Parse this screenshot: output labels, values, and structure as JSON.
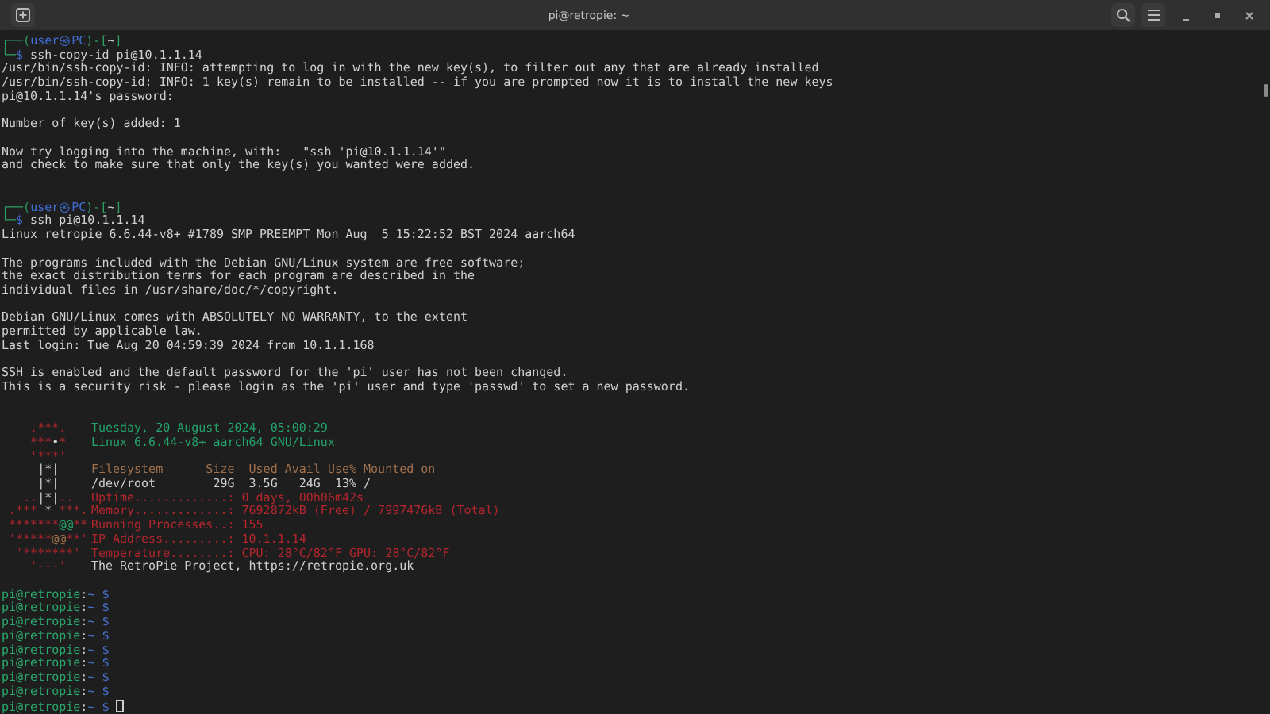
{
  "window": {
    "title": "pi@retropie: ~"
  },
  "lines": [
    {
      "kind": "text",
      "spans": [
        {
          "kind": "frame",
          "text": "┌──("
        },
        {
          "kind": "user",
          "text": "user㉿PC"
        },
        {
          "kind": "frame",
          "text": ")-["
        },
        {
          "kind": "plain",
          "text": "~"
        },
        {
          "kind": "frame",
          "text": "]"
        }
      ]
    },
    {
      "kind": "text",
      "spans": [
        {
          "kind": "frame",
          "text": "└─"
        },
        {
          "kind": "user",
          "text": "$"
        },
        {
          "kind": "plain",
          "text": " ssh-copy-id pi@10.1.1.14"
        }
      ]
    },
    {
      "kind": "text",
      "spans": [
        {
          "kind": "plain",
          "text": "/usr/bin/ssh-copy-id: INFO: attempting to log in with the new key(s), to filter out any that are already installed"
        }
      ]
    },
    {
      "kind": "text",
      "spans": [
        {
          "kind": "plain",
          "text": "/usr/bin/ssh-copy-id: INFO: 1 key(s) remain to be installed -- if you are prompted now it is to install the new keys"
        }
      ]
    },
    {
      "kind": "text",
      "spans": [
        {
          "kind": "plain",
          "text": "pi@10.1.1.14's password:"
        }
      ]
    },
    {
      "kind": "blank"
    },
    {
      "kind": "text",
      "spans": [
        {
          "kind": "plain",
          "text": "Number of key(s) added: 1"
        }
      ]
    },
    {
      "kind": "blank"
    },
    {
      "kind": "text",
      "spans": [
        {
          "kind": "plain",
          "text": "Now try logging into the machine, with:   \"ssh 'pi@10.1.1.14'\""
        }
      ]
    },
    {
      "kind": "text",
      "spans": [
        {
          "kind": "plain",
          "text": "and check to make sure that only the key(s) you wanted were added."
        }
      ]
    },
    {
      "kind": "blank"
    },
    {
      "kind": "blank"
    },
    {
      "kind": "text",
      "spans": [
        {
          "kind": "frame",
          "text": "┌──("
        },
        {
          "kind": "user",
          "text": "user㉿PC"
        },
        {
          "kind": "frame",
          "text": ")-["
        },
        {
          "kind": "plain",
          "text": "~"
        },
        {
          "kind": "frame",
          "text": "]"
        }
      ]
    },
    {
      "kind": "text",
      "spans": [
        {
          "kind": "frame",
          "text": "└─"
        },
        {
          "kind": "user",
          "text": "$"
        },
        {
          "kind": "plain",
          "text": " ssh pi@10.1.1.14"
        }
      ]
    },
    {
      "kind": "text",
      "spans": [
        {
          "kind": "plain",
          "text": "Linux retropie 6.6.44-v8+ #1789 SMP PREEMPT Mon Aug  5 15:22:52 BST 2024 aarch64"
        }
      ]
    },
    {
      "kind": "blank"
    },
    {
      "kind": "text",
      "spans": [
        {
          "kind": "plain",
          "text": "The programs included with the Debian GNU/Linux system are free software;"
        }
      ]
    },
    {
      "kind": "text",
      "spans": [
        {
          "kind": "plain",
          "text": "the exact distribution terms for each program are described in the"
        }
      ]
    },
    {
      "kind": "text",
      "spans": [
        {
          "kind": "plain",
          "text": "individual files in /usr/share/doc/*/copyright."
        }
      ]
    },
    {
      "kind": "blank"
    },
    {
      "kind": "text",
      "spans": [
        {
          "kind": "plain",
          "text": "Debian GNU/Linux comes with ABSOLUTELY NO WARRANTY, to the extent"
        }
      ]
    },
    {
      "kind": "text",
      "spans": [
        {
          "kind": "plain",
          "text": "permitted by applicable law."
        }
      ]
    },
    {
      "kind": "text",
      "spans": [
        {
          "kind": "plain",
          "text": "Last login: Tue Aug 20 04:59:39 2024 from 10.1.1.168"
        }
      ]
    },
    {
      "kind": "blank"
    },
    {
      "kind": "text",
      "spans": [
        {
          "kind": "plain",
          "text": "SSH is enabled and the default password for the 'pi' user has not been changed."
        }
      ]
    },
    {
      "kind": "text",
      "spans": [
        {
          "kind": "plain",
          "text": "This is a security risk - please login as the 'pi' user and type 'passwd' to set a new password."
        }
      ]
    },
    {
      "kind": "blank"
    },
    {
      "kind": "blank"
    },
    {
      "kind": "motd",
      "logo": [
        [
          {
            "kind": "red",
            "text": "    .***."
          }
        ],
        [
          {
            "kind": "red",
            "text": "    ***"
          },
          {
            "kind": "plain",
            "text": "•"
          },
          {
            "kind": "red",
            "text": "*"
          }
        ],
        [
          {
            "kind": "red",
            "text": "    '***'"
          }
        ],
        [
          {
            "kind": "plain",
            "text": "     |*|"
          }
        ],
        [
          {
            "kind": "plain",
            "text": "     |*|"
          }
        ],
        [
          {
            "kind": "red",
            "text": "   .."
          },
          {
            "kind": "plain",
            "text": "|*|"
          },
          {
            "kind": "red",
            "text": ".."
          }
        ],
        [
          {
            "kind": "red",
            "text": " .*** "
          },
          {
            "kind": "plain",
            "text": "*"
          },
          {
            "kind": "red",
            "text": " ***."
          }
        ],
        [
          {
            "kind": "red",
            "text": " *******"
          },
          {
            "kind": "green",
            "text": "@@"
          },
          {
            "kind": "red",
            "text": "**"
          }
        ],
        [
          {
            "kind": "red",
            "text": " '*****"
          },
          {
            "kind": "brown",
            "text": "@@"
          },
          {
            "kind": "red",
            "text": "**'"
          }
        ],
        [
          {
            "kind": "red",
            "text": "  '*******'"
          }
        ],
        [
          {
            "kind": "red",
            "text": "    '---'"
          }
        ]
      ],
      "info": [
        {
          "kind": "text",
          "spans": [
            {
              "kind": "green",
              "text": "Tuesday, 20 August 2024, 05:00:29"
            }
          ]
        },
        {
          "kind": "text",
          "spans": [
            {
              "kind": "green",
              "text": "Linux 6.6.44-v8+ aarch64 GNU/Linux"
            }
          ]
        },
        {
          "kind": "blank"
        },
        {
          "kind": "text",
          "spans": [
            {
              "kind": "brown",
              "text": "Filesystem      Size  Used Avail Use% Mounted on"
            }
          ]
        },
        {
          "kind": "text",
          "spans": [
            {
              "kind": "plain",
              "text": "/dev/root        29G  3.5G   24G  13% /"
            }
          ]
        },
        {
          "kind": "text",
          "spans": [
            {
              "kind": "red",
              "text": "Uptime.............: 0 days, 00h06m42s"
            }
          ]
        },
        {
          "kind": "text",
          "spans": [
            {
              "kind": "red",
              "text": "Memory.............: 7692872kB (Free) / 7997476kB (Total)"
            }
          ]
        },
        {
          "kind": "text",
          "spans": [
            {
              "kind": "red",
              "text": "Running Processes..: 155"
            }
          ]
        },
        {
          "kind": "text",
          "spans": [
            {
              "kind": "red",
              "text": "IP Address.........: 10.1.1.14"
            }
          ]
        },
        {
          "kind": "text",
          "spans": [
            {
              "kind": "red",
              "text": "Temperature........: CPU: 28°C/82°F GPU: 28°C/82°F"
            }
          ]
        },
        {
          "kind": "text",
          "spans": [
            {
              "kind": "plain",
              "text": "The RetroPie Project, https://retropie.org.uk"
            }
          ]
        }
      ]
    },
    {
      "kind": "blank"
    },
    {
      "kind": "text",
      "spans": [
        {
          "kind": "host",
          "text": "pi@retropie"
        },
        {
          "kind": "plain",
          "text": ":"
        },
        {
          "kind": "path",
          "text": "~ $"
        }
      ]
    },
    {
      "kind": "text",
      "spans": [
        {
          "kind": "host",
          "text": "pi@retropie"
        },
        {
          "kind": "plain",
          "text": ":"
        },
        {
          "kind": "path",
          "text": "~ $"
        }
      ]
    },
    {
      "kind": "text",
      "spans": [
        {
          "kind": "host",
          "text": "pi@retropie"
        },
        {
          "kind": "plain",
          "text": ":"
        },
        {
          "kind": "path",
          "text": "~ $"
        }
      ]
    },
    {
      "kind": "text",
      "spans": [
        {
          "kind": "host",
          "text": "pi@retropie"
        },
        {
          "kind": "plain",
          "text": ":"
        },
        {
          "kind": "path",
          "text": "~ $"
        }
      ]
    },
    {
      "kind": "text",
      "spans": [
        {
          "kind": "host",
          "text": "pi@retropie"
        },
        {
          "kind": "plain",
          "text": ":"
        },
        {
          "kind": "path",
          "text": "~ $"
        }
      ]
    },
    {
      "kind": "text",
      "spans": [
        {
          "kind": "host",
          "text": "pi@retropie"
        },
        {
          "kind": "plain",
          "text": ":"
        },
        {
          "kind": "path",
          "text": "~ $"
        }
      ]
    },
    {
      "kind": "text",
      "spans": [
        {
          "kind": "host",
          "text": "pi@retropie"
        },
        {
          "kind": "plain",
          "text": ":"
        },
        {
          "kind": "path",
          "text": "~ $"
        }
      ]
    },
    {
      "kind": "text",
      "spans": [
        {
          "kind": "host",
          "text": "pi@retropie"
        },
        {
          "kind": "plain",
          "text": ":"
        },
        {
          "kind": "path",
          "text": "~ $"
        }
      ]
    },
    {
      "kind": "cursor",
      "spans": [
        {
          "kind": "host",
          "text": "pi@retropie"
        },
        {
          "kind": "plain",
          "text": ":"
        },
        {
          "kind": "path",
          "text": "~ $"
        }
      ]
    }
  ]
}
